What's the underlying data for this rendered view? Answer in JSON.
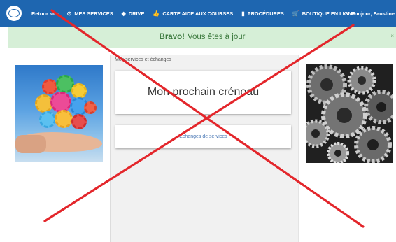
{
  "nav": {
    "items": [
      {
        "label": "Retour site",
        "icon": ""
      },
      {
        "label": "MES SERVICES",
        "icon": "clock-icon"
      },
      {
        "label": "DRIVE",
        "icon": "car-icon"
      },
      {
        "label": "CARTE AIDE AUX COURSES",
        "icon": "thumbs-up-icon"
      },
      {
        "label": "PROCÉDURES",
        "icon": "book-icon"
      },
      {
        "label": "BOUTIQUE EN LIGNE",
        "icon": "cart-icon"
      }
    ],
    "greeting": "Bonjour, Faustine"
  },
  "alert": {
    "strong": "Bravo!",
    "text": "Vous êtes à jour",
    "close": "×"
  },
  "breadcrumb": "Mes services et échanges",
  "cards": {
    "next_slot": "Mon prochain créneau",
    "exchanges_link": "Echanges de services"
  },
  "colors": {
    "nav_bg": "#1e66b0",
    "alert_bg": "#d6efd7",
    "alert_text": "#3c7a3e",
    "overlay_x": "#e3262b"
  }
}
